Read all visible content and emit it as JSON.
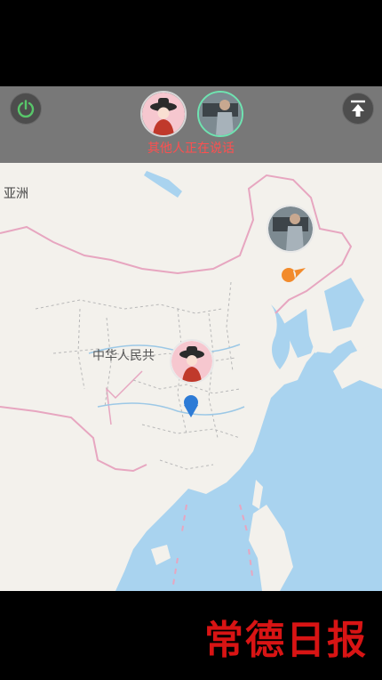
{
  "toolbar": {
    "power_icon": "power-icon",
    "pin_top_icon": "upload-top-icon",
    "talking_text": "其他人正在说话"
  },
  "map": {
    "label_asia": "亚洲",
    "label_china": "中华人民共",
    "markers": [
      {
        "name": "female-avatar-marker",
        "color": "#2d7bd6"
      },
      {
        "name": "male-avatar-marker",
        "color": "#f28b2c"
      }
    ]
  },
  "footer": {
    "logo_text": "常德日报"
  },
  "colors": {
    "toolbar_bg": "#6e6e6e",
    "talking_red": "#ff4f4f",
    "logo_red": "#d81414",
    "sea": "#a9d3ef",
    "land": "#f3f1ec"
  }
}
